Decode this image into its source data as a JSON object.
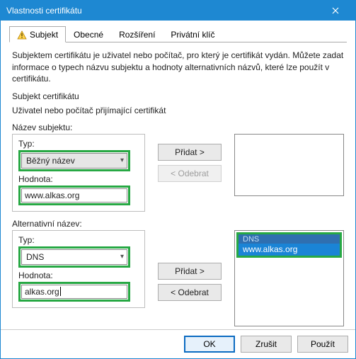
{
  "window": {
    "title": "Vlastnosti certifikátu"
  },
  "tabs": {
    "subjekt": "Subjekt",
    "obecne": "Obecné",
    "rozsireni": "Rozšíření",
    "privatni": "Privátní klíč"
  },
  "text": {
    "description": "Subjektem certifikátu je uživatel nebo počítač, pro který je certifikát vydán. Můžete zadat informace o typech názvu subjektu a hodnoty alternativních názvů, které lze použít v certifikátu.",
    "subject_heading": "Subjekt certifikátu",
    "recipient": "Uživatel nebo počítač přijímající certifikát",
    "subject_name_label": "Název subjektu:",
    "alt_name_label": "Alternativní název:",
    "type_label": "Typ:",
    "value_label": "Hodnota:"
  },
  "subject_name": {
    "type_selected": "Běžný název",
    "value": "www.alkas.org"
  },
  "alt_name": {
    "type_selected": "DNS",
    "value": "alkas.org"
  },
  "alt_list": {
    "item_type": "DNS",
    "item_value": "www.alkas.org"
  },
  "buttons": {
    "add": "Přidat >",
    "remove": "< Odebrat",
    "ok": "OK",
    "cancel": "Zrušit",
    "apply": "Použít"
  },
  "colors": {
    "titlebar": "#1e88d2",
    "highlight": "#27a844",
    "selection_bg": "#1a84d6"
  }
}
